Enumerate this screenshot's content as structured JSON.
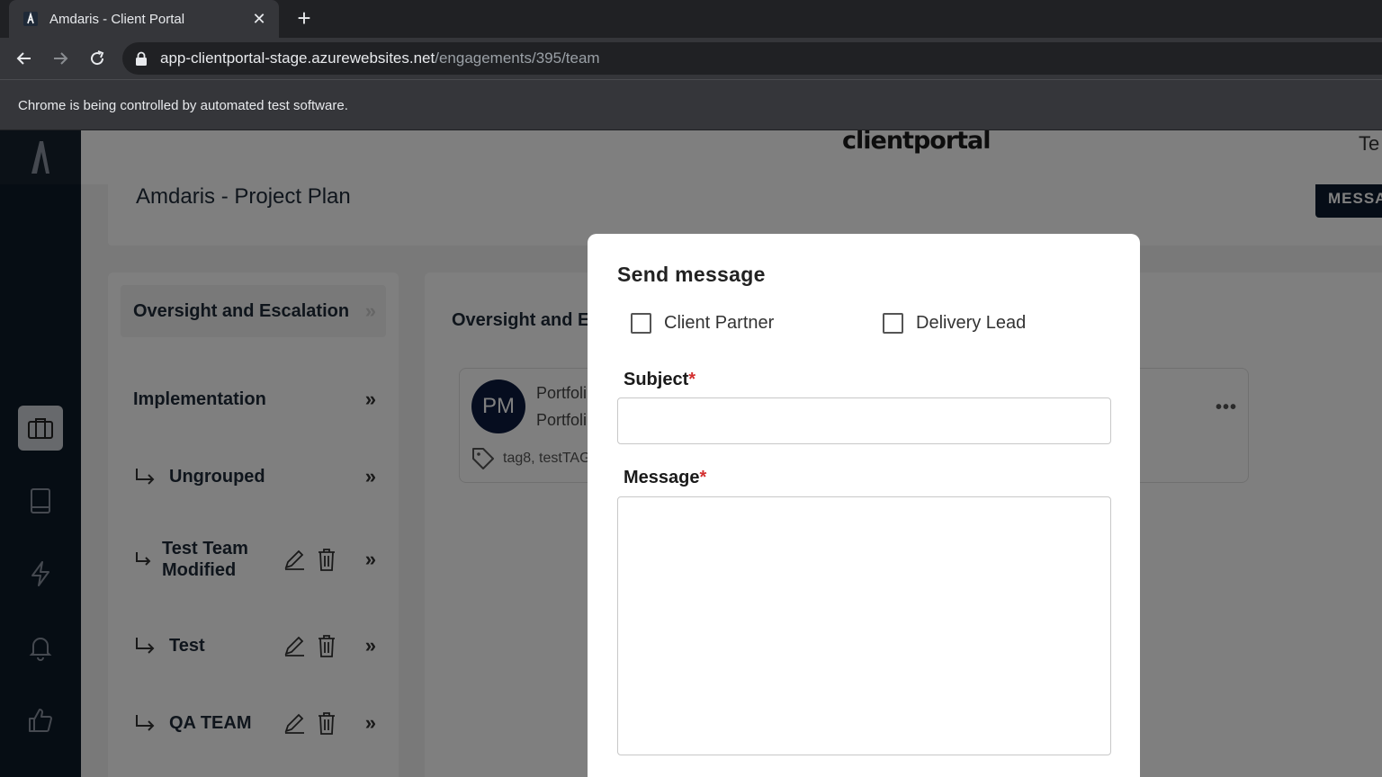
{
  "browser": {
    "tab_title": "Amdaris - Client Portal",
    "new_tab_label": "+",
    "close_tab_label": "✕",
    "url_host": "app-clientportal-stage.azurewebsites.net",
    "url_path": "/engagements/395/team",
    "infobar_text": "Chrome is being controlled by automated test software."
  },
  "app": {
    "brand": "clientportal",
    "user_partial": "Te",
    "project_title": "Amdaris - Project Plan",
    "message_button": "MESSA",
    "sidebar_icons": [
      "briefcase-icon",
      "book-icon",
      "lightning-icon",
      "bell-icon",
      "thumbs-up-icon"
    ],
    "groups": [
      {
        "label": "Oversight and Escalation",
        "arrow": "»",
        "selected": true,
        "sub": false,
        "editable": false
      },
      {
        "label": "Implementation",
        "arrow": "»",
        "selected": false,
        "sub": false,
        "editable": false
      },
      {
        "label": "Ungrouped",
        "arrow": "»",
        "selected": false,
        "sub": true,
        "editable": false
      },
      {
        "label": "Test Team Modified",
        "arrow": "»",
        "selected": false,
        "sub": true,
        "editable": true
      },
      {
        "label": "Test",
        "arrow": "»",
        "selected": false,
        "sub": true,
        "editable": true
      },
      {
        "label": "QA TEAM",
        "arrow": "»",
        "selected": false,
        "sub": true,
        "editable": true
      }
    ],
    "panel_title": "Oversight and Es",
    "member": {
      "initials": "PM",
      "line1": "Portfoli",
      "line2": "Portfoli",
      "tags": "tag8, testTAG",
      "more": "•••"
    }
  },
  "modal": {
    "title": "Send message",
    "checkbox_client_partner": "Client Partner",
    "checkbox_delivery_lead": "Delivery Lead",
    "subject_label": "Subject",
    "message_label": "Message",
    "required_mark": "*",
    "subject_value": "",
    "message_value": ""
  }
}
